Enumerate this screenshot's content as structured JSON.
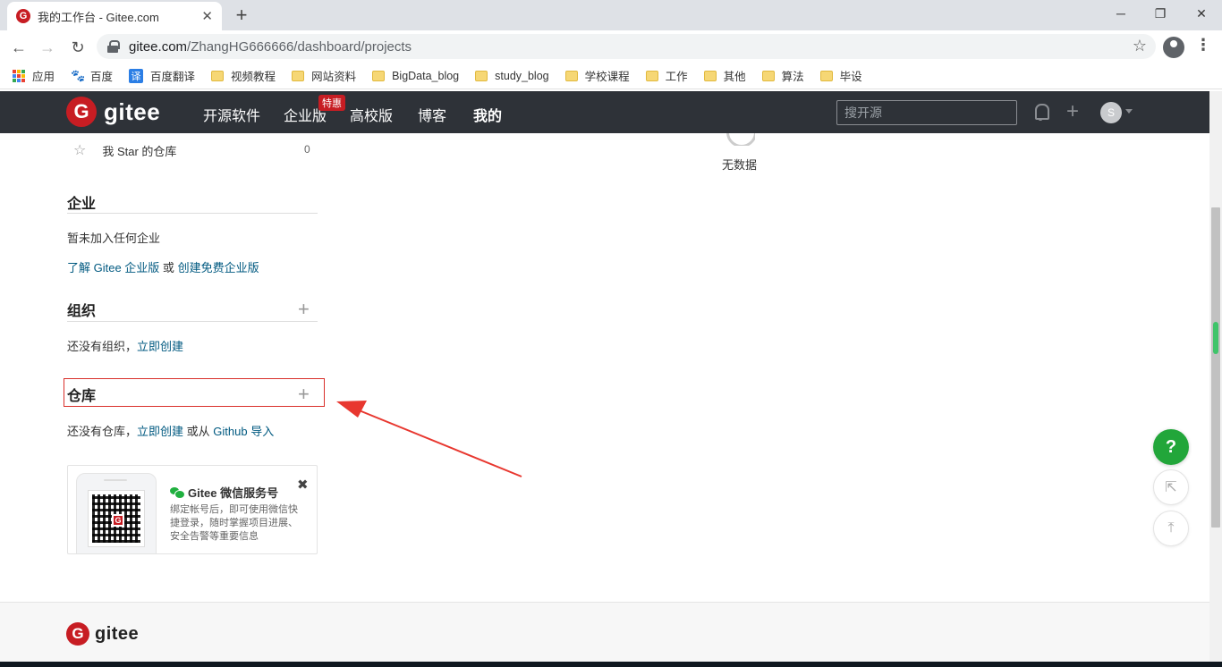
{
  "browser": {
    "tab_title": "我的工作台 - Gitee.com",
    "favicon_letter": "G",
    "url_host": "gitee.com",
    "url_path": "/ZhangHG666666/dashboard/projects",
    "bookmarks": [
      "应用",
      "百度",
      "百度翻译",
      "视频教程",
      "网站资料",
      "BigData_blog",
      "study_blog",
      "学校课程",
      "工作",
      "其他",
      "算法",
      "毕设"
    ]
  },
  "header": {
    "logo_text": "gitee",
    "nav": [
      "开源软件",
      "企业版",
      "高校版",
      "博客",
      "我的"
    ],
    "badge": "特惠",
    "search_placeholder": "搜开源",
    "avatar_letter": "S"
  },
  "sidebar": {
    "star_repo_label": "我 Star 的仓库",
    "star_repo_count": "0",
    "enterprise": {
      "title": "企业",
      "empty": "暂未加入任何企业",
      "learn_link": "了解 Gitee 企业版",
      "or": "或",
      "create_link": "创建免费企业版"
    },
    "org": {
      "title": "组织",
      "empty": "还没有组织，",
      "create_link": "立即创建"
    },
    "repo": {
      "title": "仓库",
      "empty": "还没有仓库，",
      "create_link": "立即创建",
      "or_from": "或从",
      "import_link": "Github 导入"
    },
    "wechat": {
      "title": "Gitee 微信服务号",
      "desc": "绑定帐号后，即可使用微信快捷登录，随时掌握项目进展、安全告警等重要信息"
    }
  },
  "main": {
    "no_data": "无数据"
  },
  "footer": {
    "logo_text": "gitee"
  },
  "floating": {
    "help": "?"
  },
  "colors": {
    "brand": "#c71d23",
    "header_bg": "#2e3238",
    "link": "#005980",
    "highlight_border": "#d9302b",
    "help_green": "#22a63a"
  }
}
